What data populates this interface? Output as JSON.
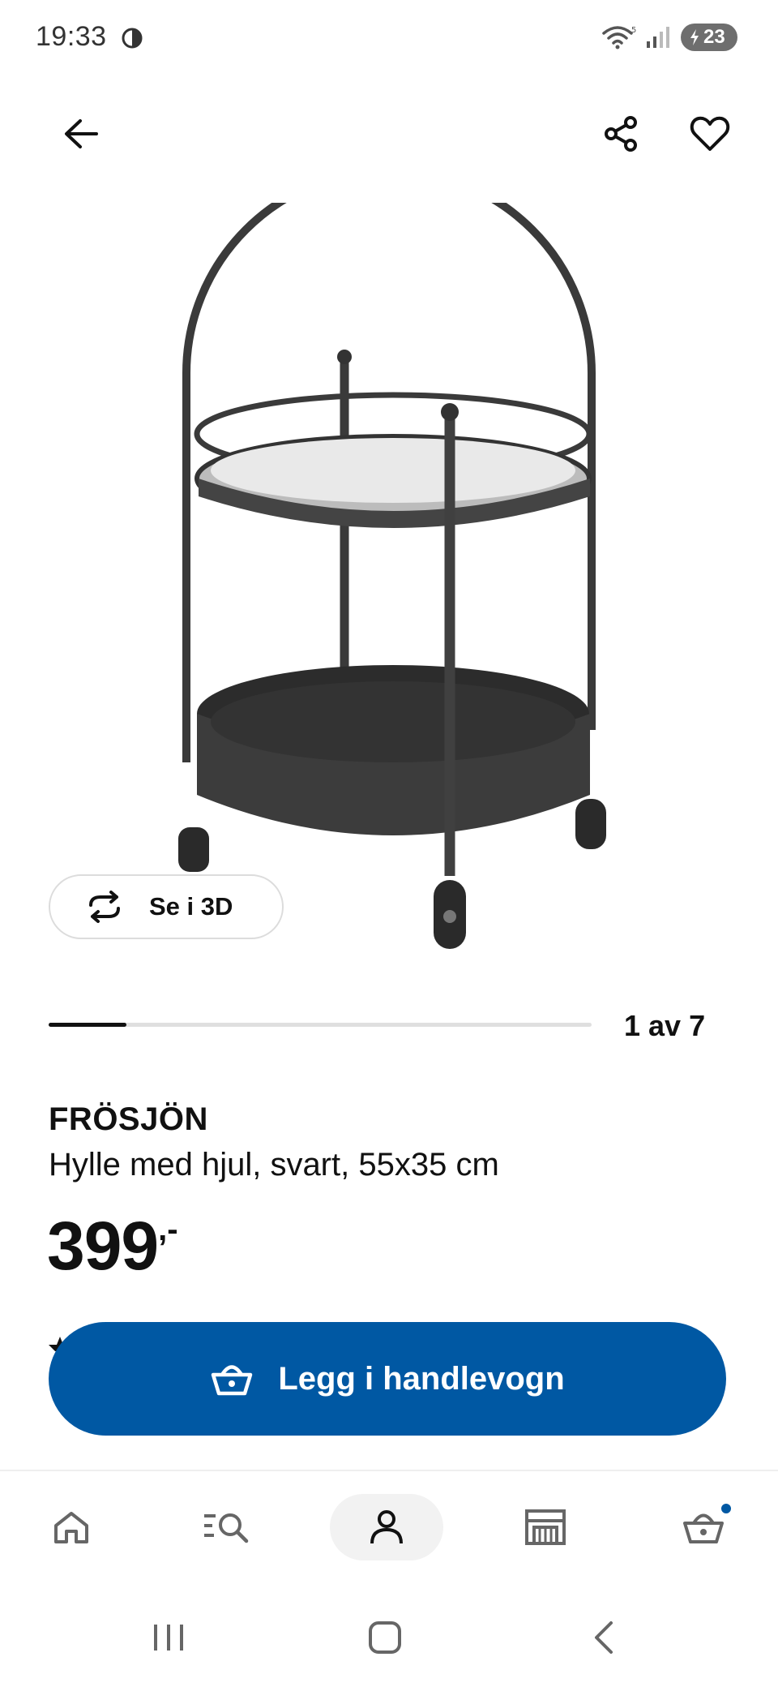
{
  "status_bar": {
    "time": "19:33",
    "battery": "23",
    "icons": [
      "wifi-icon",
      "signal-icon",
      "battery-charging-icon"
    ]
  },
  "app_bar": {
    "icons": [
      "back-arrow-icon",
      "share-icon",
      "heart-icon"
    ]
  },
  "gallery": {
    "view_3d_label": "Se i 3D",
    "counter": "1 av 7",
    "current": 1,
    "total": 7
  },
  "product": {
    "name": "FRÖSJÖN",
    "description": "Hylle med hjul, svart, 55x35 cm",
    "price": "399",
    "price_suffix": ",-"
  },
  "cta": {
    "add_to_cart_label": "Legg i handlevogn",
    "color": "#0058a3"
  },
  "bottom_nav": {
    "items": [
      "home-icon",
      "search-icon",
      "profile-icon",
      "store-icon",
      "cart-icon"
    ],
    "active": "profile-icon"
  },
  "system_nav": [
    "recents-icon",
    "home-circle-icon",
    "back-chevron-icon"
  ]
}
